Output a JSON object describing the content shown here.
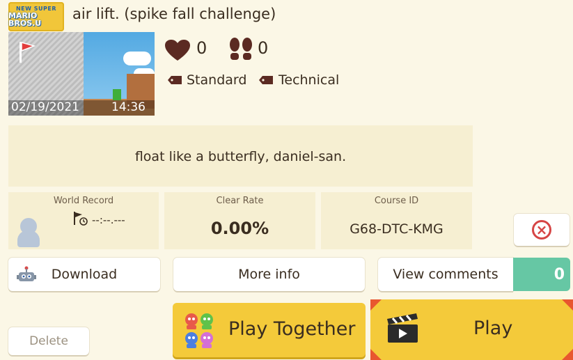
{
  "header": {
    "game_logo_line1": "NEW SUPER",
    "game_logo_line2": "MARIO BROS.U",
    "title": "air lift. (spike fall challenge)"
  },
  "thumbnail": {
    "date": "02/19/2021",
    "time": "14:36"
  },
  "stats": {
    "likes": "0",
    "plays": "0",
    "tags": [
      "Standard",
      "Technical"
    ]
  },
  "description": "float like a butterfly, daniel-san.",
  "info": {
    "world_record_label": "World Record",
    "world_record_value": "--:--.---",
    "clear_rate_label": "Clear Rate",
    "clear_rate_value": "0.00%",
    "course_id_label": "Course ID",
    "course_id_value": "G68-DTC-KMG"
  },
  "buttons": {
    "download": "Download",
    "more_info": "More info",
    "view_comments": "View comments",
    "comments_count": "0",
    "delete": "Delete",
    "play_together": "Play Together",
    "play": "Play"
  },
  "colors": {
    "background": "#fbf7e6",
    "panel": "#f6efd2",
    "accent_yellow": "#f4ca3a",
    "comments_green": "#66c7a4",
    "close_red": "#d64545",
    "play_corner_red": "#e8572f"
  }
}
